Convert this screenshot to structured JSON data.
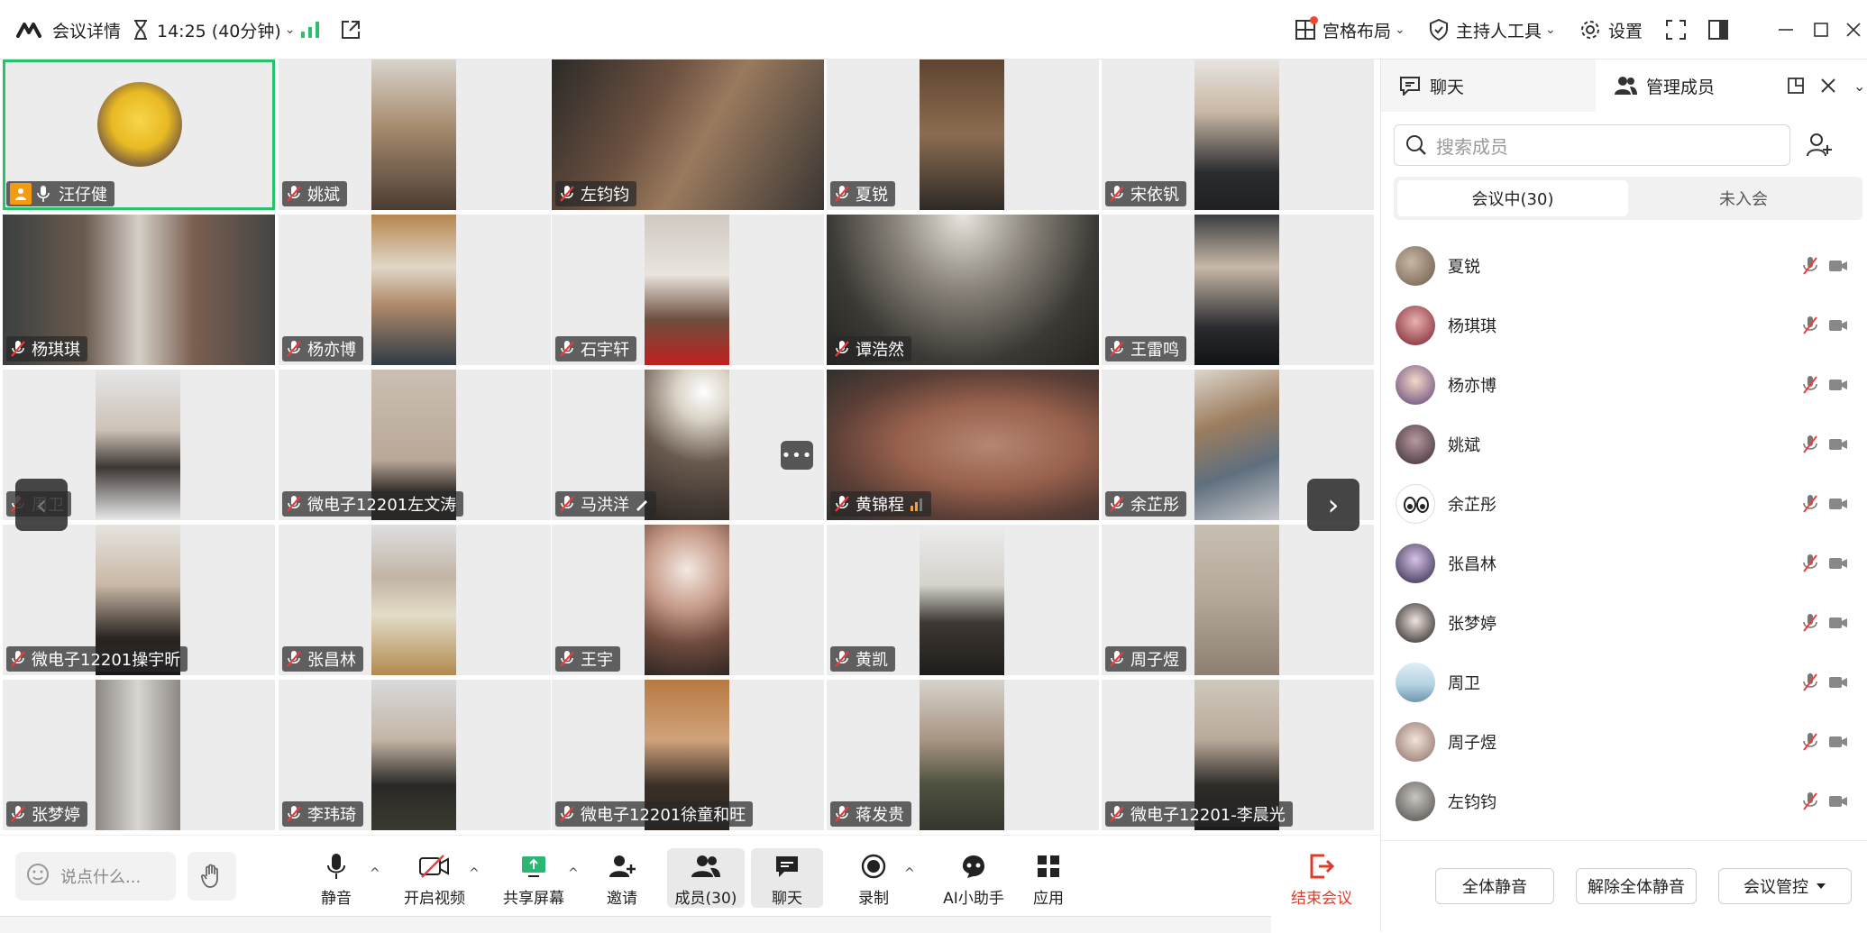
{
  "topbar": {
    "meeting_details": "会议详情",
    "timer": "14:25 (40分钟)",
    "layout": "宫格布局",
    "host_tools": "主持人工具",
    "settings": "设置"
  },
  "participants": [
    {
      "name": "汪仔健",
      "host": true
    },
    {
      "name": "姚斌"
    },
    {
      "name": "左钧钧"
    },
    {
      "name": "夏锐"
    },
    {
      "name": "宋依钒"
    },
    {
      "name": "杨琪琪"
    },
    {
      "name": "杨亦博"
    },
    {
      "name": "石宇轩"
    },
    {
      "name": "谭浩然"
    },
    {
      "name": "王雷鸣"
    },
    {
      "name": "周卫"
    },
    {
      "name": "微电子12201左文涛"
    },
    {
      "name": "马洪洋"
    },
    {
      "name": "黄锦程"
    },
    {
      "name": "余芷彤"
    },
    {
      "name": "微电子12201操宇昕"
    },
    {
      "name": "张昌林"
    },
    {
      "name": "王宇"
    },
    {
      "name": "黄凯"
    },
    {
      "name": "周子煜"
    },
    {
      "name": "张梦婷"
    },
    {
      "name": "李玮琦"
    },
    {
      "name": "微电子12201徐童和旺"
    },
    {
      "name": "蒋发贵"
    },
    {
      "name": "微电子12201-李晨光"
    }
  ],
  "toolbar": {
    "say_placeholder": "说点什么...",
    "mute": "静音",
    "video": "开启视频",
    "share": "共享屏幕",
    "invite": "邀请",
    "members": "成员(30)",
    "chat": "聊天",
    "record": "录制",
    "ai": "AI小助手",
    "apps": "应用",
    "end": "结束会议"
  },
  "side": {
    "tab_chat": "聊天",
    "tab_members": "管理成员",
    "search_placeholder": "搜索成员",
    "seg_in": "会议中(30)",
    "seg_out": "未入会",
    "members": [
      "夏锐",
      "杨琪琪",
      "杨亦博",
      "姚斌",
      "余芷彤",
      "张昌林",
      "张梦婷",
      "周卫",
      "周子煜",
      "左钧钧"
    ],
    "mute_all": "全体静音",
    "unmute_all": "解除全体静音",
    "control": "会议管控"
  },
  "colors": {
    "active_outline": "#27c26b",
    "end_red": "#e03b2a",
    "share_green": "#2bb673",
    "signal_green": "#27c26b"
  }
}
